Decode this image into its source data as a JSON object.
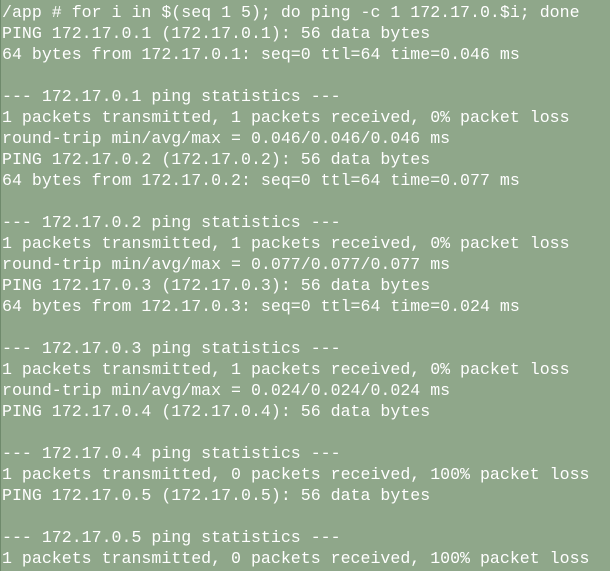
{
  "terminal": {
    "lines": [
      "/app # for i in $(seq 1 5); do ping -c 1 172.17.0.$i; done",
      "PING 172.17.0.1 (172.17.0.1): 56 data bytes",
      "64 bytes from 172.17.0.1: seq=0 ttl=64 time=0.046 ms",
      "",
      "--- 172.17.0.1 ping statistics ---",
      "1 packets transmitted, 1 packets received, 0% packet loss",
      "round-trip min/avg/max = 0.046/0.046/0.046 ms",
      "PING 172.17.0.2 (172.17.0.2): 56 data bytes",
      "64 bytes from 172.17.0.2: seq=0 ttl=64 time=0.077 ms",
      "",
      "--- 172.17.0.2 ping statistics ---",
      "1 packets transmitted, 1 packets received, 0% packet loss",
      "round-trip min/avg/max = 0.077/0.077/0.077 ms",
      "PING 172.17.0.3 (172.17.0.3): 56 data bytes",
      "64 bytes from 172.17.0.3: seq=0 ttl=64 time=0.024 ms",
      "",
      "--- 172.17.0.3 ping statistics ---",
      "1 packets transmitted, 1 packets received, 0% packet loss",
      "round-trip min/avg/max = 0.024/0.024/0.024 ms",
      "PING 172.17.0.4 (172.17.0.4): 56 data bytes",
      "",
      "--- 172.17.0.4 ping statistics ---",
      "1 packets transmitted, 0 packets received, 100% packet loss",
      "PING 172.17.0.5 (172.17.0.5): 56 data bytes",
      "",
      "--- 172.17.0.5 ping statistics ---",
      "1 packets transmitted, 0 packets received, 100% packet loss",
      ""
    ]
  },
  "colors": {
    "background": "#8fa78a",
    "text": "#ffffff"
  }
}
